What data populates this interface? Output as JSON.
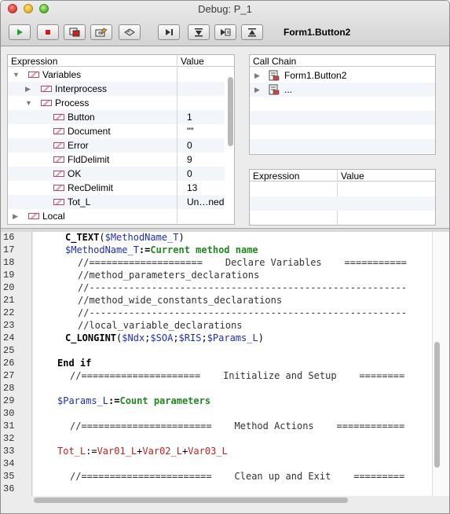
{
  "window": {
    "title": "Debug: P_1"
  },
  "toolbar": {
    "buttons": [
      "play-icon",
      "stop-icon",
      "abort-icon",
      "edit-icon",
      "disk-icon",
      "step-over-icon",
      "step-into-icon",
      "step-out-icon",
      "up-icon"
    ],
    "form_label": "Form1.Button2"
  },
  "expression_pane": {
    "header_expression": "Expression",
    "header_value": "Value",
    "rows": [
      {
        "label": "Variables",
        "value": "",
        "level": 0,
        "expanded": true
      },
      {
        "label": "Interprocess",
        "value": "",
        "level": 1,
        "expanded": false
      },
      {
        "label": "Process",
        "value": "",
        "level": 1,
        "expanded": true
      },
      {
        "label": "Button",
        "value": "1",
        "level": 2
      },
      {
        "label": "Document",
        "value": "\"\"",
        "level": 2
      },
      {
        "label": "Error",
        "value": "0",
        "level": 2
      },
      {
        "label": "FldDelimit",
        "value": "9",
        "level": 2
      },
      {
        "label": "OK",
        "value": "0",
        "level": 2
      },
      {
        "label": "RecDelimit",
        "value": "13",
        "level": 2
      },
      {
        "label": "Tot_L",
        "value": "Un…ned",
        "level": 2
      },
      {
        "label": "Local",
        "value": "",
        "level": 0,
        "expanded": false
      }
    ]
  },
  "call_chain": {
    "header": "Call Chain",
    "items": [
      "Form1.Button2",
      "..."
    ]
  },
  "watch_pane": {
    "header_expression": "Expression",
    "header_value": "Value"
  },
  "code": {
    "line_numbers": [
      "16",
      "17",
      "18",
      "19",
      "20",
      "21",
      "22",
      "23",
      "24",
      "25",
      "26",
      "27",
      "28",
      "29",
      "30",
      "31",
      "32",
      "33",
      "34",
      "35",
      "36"
    ]
  }
}
